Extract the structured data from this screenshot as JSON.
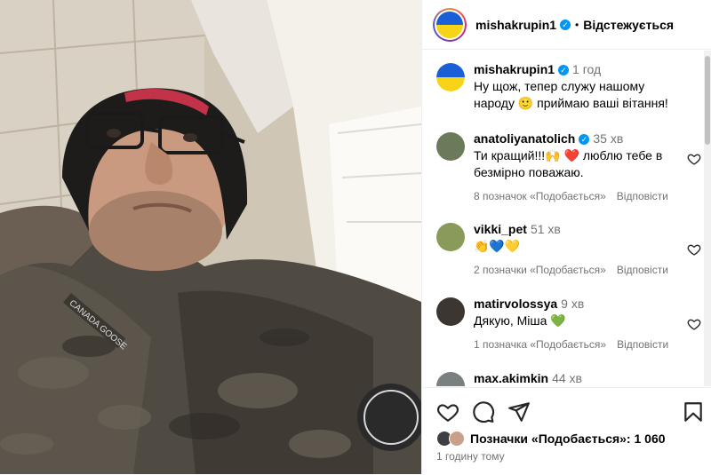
{
  "header": {
    "username": "mishakrupin1",
    "separator": "•",
    "follow_label": "Відстежується"
  },
  "caption": {
    "username": "mishakrupin1",
    "time": "1 год",
    "text": "Ну щож, тепер служу нашому народу 🙂 приймаю ваші вітання!"
  },
  "comments": [
    {
      "username": "anatoliyanatolich",
      "verified": true,
      "time": "35 хв",
      "text": "Ти кращий!!!🙌 ❤️ люблю тебе в безмірно поважаю.",
      "likes": "8 позначок «Подобається»",
      "reply": "Відповісти"
    },
    {
      "username": "vikki_pet",
      "verified": false,
      "time": "51 хв",
      "text": "👏💙💛",
      "likes": "2 позначки «Подобається»",
      "reply": "Відповісти"
    },
    {
      "username": "matirvolossya",
      "verified": false,
      "time": "9 хв",
      "text": "Дякую, Міша 💚",
      "likes": "1 позначка «Подобається»",
      "reply": "Відповісти"
    },
    {
      "username": "max.akimkin",
      "verified": false,
      "time": "44 хв",
      "text": "",
      "likes": "",
      "reply": ""
    }
  ],
  "footer": {
    "likes_label": "Позначки «Подобається»: 1 060",
    "posted_ago": "1 годину тому"
  },
  "icons": {
    "heart": "heart-icon",
    "comment": "comment-icon",
    "share": "share-icon",
    "save": "bookmark-icon",
    "verified": "verified-badge-icon"
  },
  "colors": {
    "accent": "#0095f6",
    "muted": "#737373",
    "flag_blue": "#1a5fd6",
    "flag_yellow": "#f7d417"
  }
}
